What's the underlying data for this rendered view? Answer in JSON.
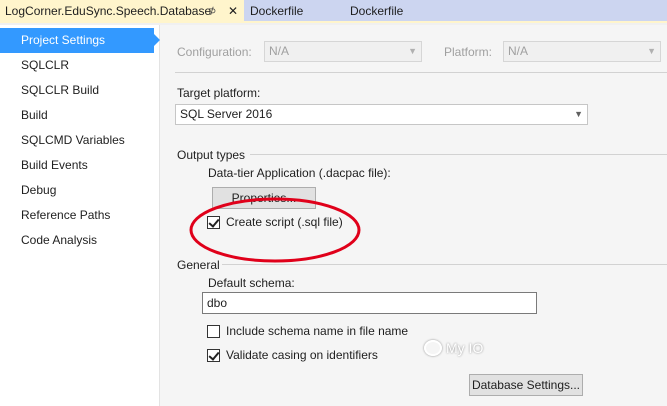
{
  "tabs": [
    {
      "label": "LogCorner.EduSync.Speech.Database",
      "pin": "⊅",
      "close": "✕"
    },
    {
      "label": "Dockerfile"
    },
    {
      "label": "Dockerfile"
    }
  ],
  "sidebar": {
    "items": [
      {
        "label": "Project Settings"
      },
      {
        "label": "SQLCLR"
      },
      {
        "label": "SQLCLR Build"
      },
      {
        "label": "Build"
      },
      {
        "label": "SQLCMD Variables"
      },
      {
        "label": "Build Events"
      },
      {
        "label": "Debug"
      },
      {
        "label": "Reference Paths"
      },
      {
        "label": "Code Analysis"
      }
    ]
  },
  "config": {
    "configuration_label": "Configuration:",
    "configuration_value": "N/A",
    "platform_label": "Platform:",
    "platform_value": "N/A"
  },
  "target": {
    "label": "Target platform:",
    "value": "SQL Server 2016"
  },
  "output": {
    "heading": "Output types",
    "dacpac_label": "Data-tier Application (.dacpac file):",
    "properties_button": "Properties...",
    "create_script_label": "Create script (.sql file)",
    "create_script_checked": true
  },
  "general": {
    "heading": "General",
    "schema_label": "Default schema:",
    "schema_value": "dbo",
    "include_schema_label": "Include schema name in file name",
    "include_schema_checked": false,
    "validate_casing_label": "Validate casing on identifiers",
    "validate_casing_checked": true,
    "db_settings_button": "Database Settings..."
  },
  "watermark": {
    "text": "My IO"
  },
  "colors": {
    "selection": "#3399ff",
    "tab_active": "#fff5cc",
    "annotation": "#e0001a"
  }
}
